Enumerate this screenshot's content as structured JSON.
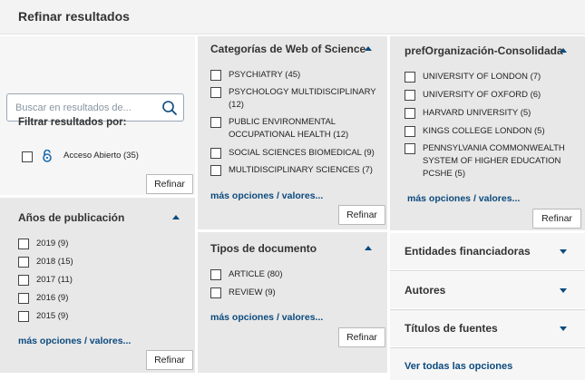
{
  "header": {
    "title": "Refinar resultados"
  },
  "search": {
    "placeholder": "Buscar en resultados de..."
  },
  "filter": {
    "title": "Filtrar resultados por:",
    "open_access_label": "Acceso Abierto (35)",
    "refine_label": "Refinar"
  },
  "years": {
    "title": "Años de publicación",
    "items": [
      {
        "label": "2019 (9)"
      },
      {
        "label": "2018 (15)"
      },
      {
        "label": "2017 (11)"
      },
      {
        "label": "2016 (9)"
      },
      {
        "label": "2015 (9)"
      }
    ],
    "more": "más opciones / valores...",
    "refine_label": "Refinar"
  },
  "categories": {
    "title": "Categorías de Web of Science",
    "items": [
      {
        "label": "PSYCHIATRY (45)"
      },
      {
        "label": "PSYCHOLOGY MULTIDISCIPLINARY (12)"
      },
      {
        "label": "PUBLIC ENVIRONMENTAL OCCUPATIONAL HEALTH (12)"
      },
      {
        "label": "SOCIAL SCIENCES BIOMEDICAL (9)"
      },
      {
        "label": "MULTIDISCIPLINARY SCIENCES (7)"
      }
    ],
    "more": "más opciones / valores...",
    "refine_label": "Refinar"
  },
  "doc_types": {
    "title": "Tipos de documento",
    "items": [
      {
        "label": "ARTICLE (80)"
      },
      {
        "label": "REVIEW (9)"
      }
    ],
    "more": "más opciones / valores...",
    "refine_label": "Refinar"
  },
  "orgs": {
    "title": "prefOrganización-Consolidada",
    "items": [
      {
        "label": "UNIVERSITY OF LONDON (7)"
      },
      {
        "label": "UNIVERSITY OF OXFORD (6)"
      },
      {
        "label": "HARVARD UNIVERSITY (5)"
      },
      {
        "label": "KINGS COLLEGE LONDON (5)"
      },
      {
        "label": "PENNSYLVANIA COMMONWEALTH SYSTEM OF HIGHER EDUCATION PCSHE (5)"
      }
    ],
    "more": "más opciones / valores...",
    "refine_label": "Refinar"
  },
  "collapsed": {
    "funding": "Entidades financiadoras",
    "authors": "Autores",
    "sources": "Títulos de fuentes"
  },
  "view_all": "Ver todas las opciones",
  "colors": {
    "link": "#0b4a7e",
    "panel": "#e8e8e8"
  }
}
